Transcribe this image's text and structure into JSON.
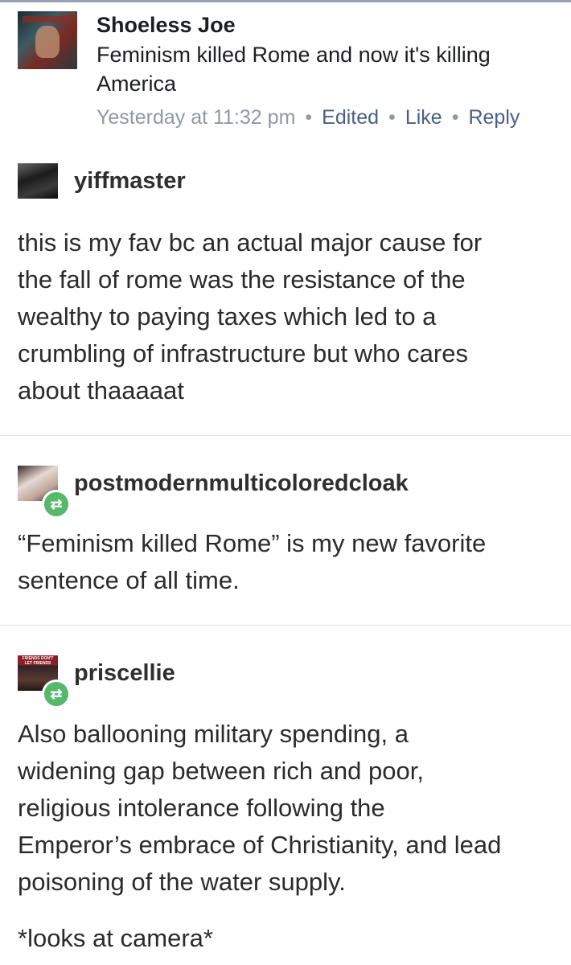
{
  "facebook_comment": {
    "author": "Shoeless Joe",
    "text": "Feminism killed Rome and now it's killing America",
    "time": "Yesterday at 11:32 pm",
    "edited": "Edited",
    "like": "Like",
    "reply": "Reply",
    "separator": "•"
  },
  "posts": [
    {
      "username": "yiffmaster",
      "lines": [
        "this is my fav bc an actual major cause for",
        "the fall of rome was the resistance of the",
        "wealthy to paying taxes which led to a",
        "crumbling of infrastructure but who cares",
        "about thaaaaat"
      ]
    },
    {
      "username": "postmodernmulticoloredcloak",
      "lines": [
        "“Feminism killed Rome” is my new favorite",
        "sentence of all time."
      ]
    },
    {
      "username": "priscellie",
      "avatar_text": "FRIENDS DON'T LET FRIENDS DRINK FRIENDS",
      "lines": [
        "Also ballooning military spending, a",
        "widening gap between rich and poor,",
        "religious intolerance following the",
        "Emperor’s embrace of Christianity, and lead",
        "poisoning of the water supply."
      ],
      "extra": "*looks at camera*"
    }
  ],
  "icons": {
    "reblog": "reblog-icon"
  },
  "colors": {
    "reblog_badge": "#56b86a",
    "fb_link": "#4b5f86",
    "fb_meta": "#9197a3"
  }
}
